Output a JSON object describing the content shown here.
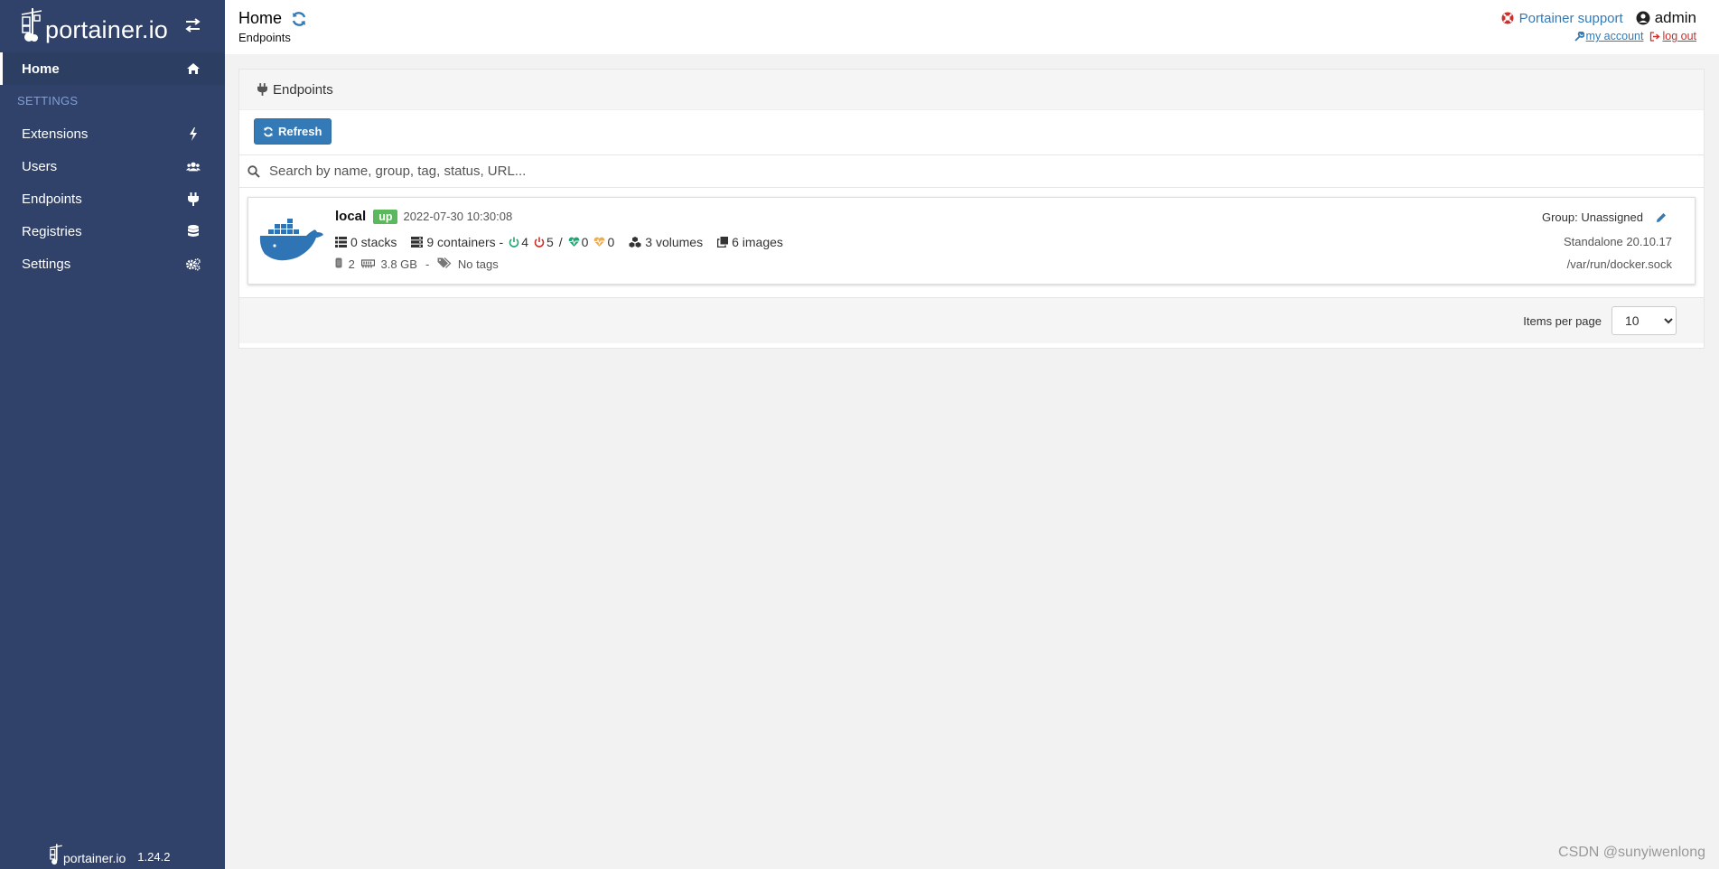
{
  "sidebar": {
    "logo_text": "portainer.io",
    "items": [
      {
        "label": "Home",
        "icon": "home-icon"
      },
      {
        "label": "Extensions",
        "icon": "bolt-icon"
      },
      {
        "label": "Users",
        "icon": "users-icon"
      },
      {
        "label": "Endpoints",
        "icon": "plug-icon"
      },
      {
        "label": "Registries",
        "icon": "database-icon"
      },
      {
        "label": "Settings",
        "icon": "cogs-icon"
      }
    ],
    "section_label": "SETTINGS",
    "footer": {
      "logo_text": "portainer.io",
      "version": "1.24.2"
    }
  },
  "header": {
    "title": "Home",
    "breadcrumb": "Endpoints",
    "support_label": "Portainer support",
    "username": "admin",
    "my_account_label": "my account",
    "logout_label": "log out"
  },
  "panel": {
    "title": "Endpoints",
    "refresh_label": "Refresh",
    "search_placeholder": "Search by name, group, tag, status, URL...",
    "items_per_page_label": "Items per page",
    "items_per_page_value": "10",
    "items_per_page_options": [
      "10"
    ]
  },
  "endpoint": {
    "name": "local",
    "status": "up",
    "timestamp": "2022-07-30 10:30:08",
    "stacks": "0 stacks",
    "containers": "9 containers -",
    "running": "4",
    "stopped": "5",
    "separator": "/",
    "healthy": "0",
    "unhealthy": "0",
    "volumes": "3 volumes",
    "images": "6 images",
    "cpu": "2",
    "memory": "3.8 GB",
    "dash": "-",
    "tags": "No tags",
    "group": "Group: Unassigned",
    "type_version": "Standalone 20.10.17",
    "url": "/var/run/docker.sock"
  },
  "watermark": "CSDN @sunyiwenlong",
  "colors": {
    "sidebar_bg": "#30426a",
    "primary": "#337ab7",
    "success": "#5cb85c",
    "danger": "#c9302c",
    "healthy": "#1fa672",
    "warning": "#f0ad4e"
  }
}
